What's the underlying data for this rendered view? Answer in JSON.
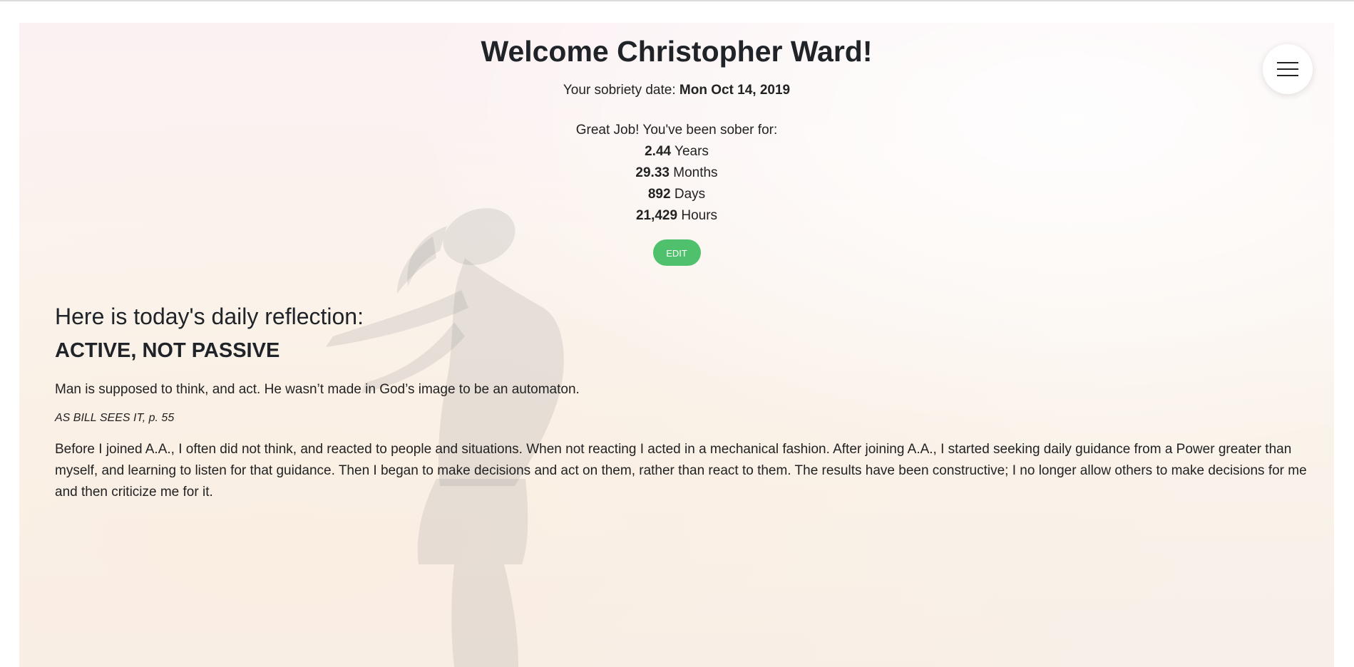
{
  "header": {
    "welcome_title": "Welcome Christopher Ward!",
    "sobriety_label": "Your sobriety date:",
    "sobriety_date": "Mon Oct 14, 2019",
    "congrats_text": "Great Job! You've been sober for:",
    "stats": [
      {
        "value": "2.44",
        "unit": "Years"
      },
      {
        "value": "29.33",
        "unit": "Months"
      },
      {
        "value": "892",
        "unit": "Days"
      },
      {
        "value": "21,429",
        "unit": "Hours"
      }
    ],
    "edit_label": "Edit"
  },
  "menu": {
    "icon": "hamburger-menu-icon"
  },
  "reflection": {
    "heading": "Here is today's daily reflection:",
    "title": "ACTIVE, NOT PASSIVE",
    "quote": "Man is supposed to think, and act. He wasn’t made in God’s image to be an automaton.",
    "source": "AS BILL SEES IT, p. 55",
    "body": "Before I joined A.A., I often did not think, and reacted to people and situations. When not reacting I acted in a mechanical fashion. After joining A.A., I started seeking daily guidance from a Power greater than myself, and learning to listen for that guidance. Then I began to make decisions and act on them, rather than react to them. The results have been constructive; I no longer allow others to make decisions for me and then criticize me for it."
  },
  "colors": {
    "edit_button": "#4fc16d",
    "text": "#222222",
    "background_tint": "#fbf3ef"
  }
}
